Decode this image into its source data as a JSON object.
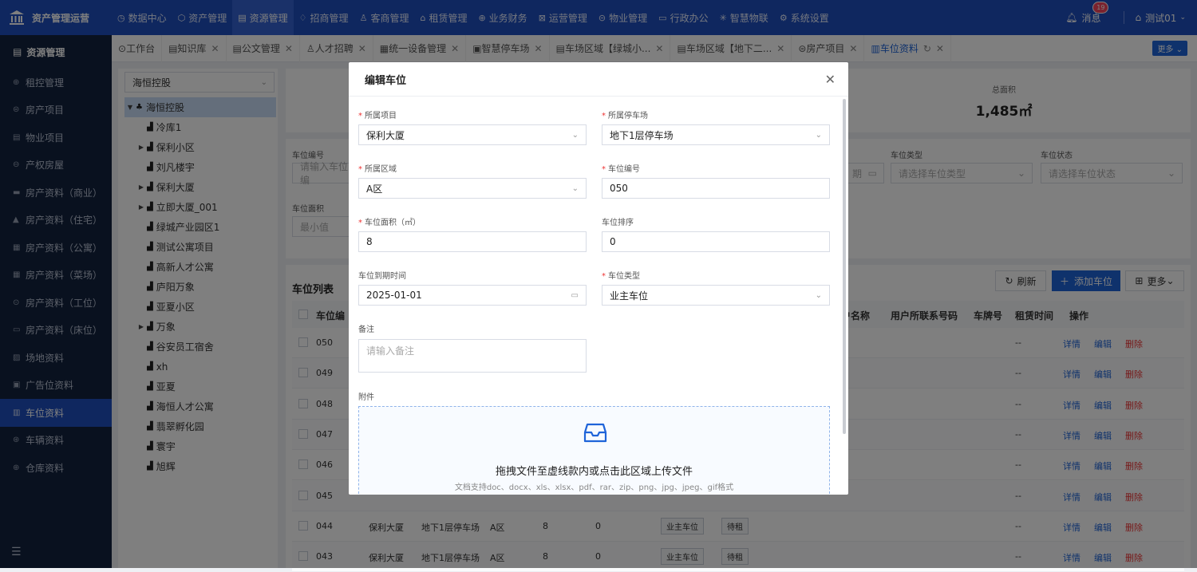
{
  "brand": {
    "title": "资产管理运营"
  },
  "topnav": [
    {
      "icon": "◷",
      "label": "数据中心"
    },
    {
      "icon": "⬡",
      "label": "资产管理"
    },
    {
      "icon": "▤",
      "label": "资源管理"
    },
    {
      "icon": "♢",
      "label": "招商管理"
    },
    {
      "icon": "♙",
      "label": "客商管理"
    },
    {
      "icon": "⌂",
      "label": "租赁管理"
    },
    {
      "icon": "⊕",
      "label": "业务财务"
    },
    {
      "icon": "⊠",
      "label": "运营管理"
    },
    {
      "icon": "⊝",
      "label": "物业管理"
    },
    {
      "icon": "▭",
      "label": "行政办公"
    },
    {
      "icon": "✳",
      "label": "智慧物联"
    },
    {
      "icon": "⚙",
      "label": "系统设置"
    }
  ],
  "topright": {
    "messages": "消息",
    "badge": "19",
    "user": "测试01"
  },
  "sidebar": {
    "title": "资源管理",
    "items": [
      "租控管理",
      "房产项目",
      "物业项目",
      "产权房屋",
      "房产资料（商业）",
      "房产资料（住宅）",
      "房产资料（公寓）",
      "房产资料（菜场）",
      "房产资料（工位）",
      "房产资料（床位）",
      "场地资料",
      "广告位资料",
      "车位资料",
      "车辆资料",
      "仓库资料"
    ]
  },
  "tabs": [
    {
      "label": "工作台",
      "closable": false
    },
    {
      "label": "知识库",
      "closable": true
    },
    {
      "label": "公文管理",
      "closable": true
    },
    {
      "label": "人才招聘",
      "closable": true
    },
    {
      "label": "统一设备管理",
      "closable": true
    },
    {
      "label": "智慧停车场",
      "closable": true
    },
    {
      "label": "车场区域【绿城小...",
      "closable": true
    },
    {
      "label": "车场区域【地下二...",
      "closable": true
    },
    {
      "label": "房产项目",
      "closable": true
    },
    {
      "label": "车位资料",
      "closable": true
    }
  ],
  "more_tabs": "更多",
  "tree": {
    "select_value": "海恒控股",
    "root": "海恒控股",
    "nodes": [
      {
        "label": "冷库1",
        "expandable": false
      },
      {
        "label": "保利小区",
        "expandable": true
      },
      {
        "label": "刘凡楼宇",
        "expandable": false
      },
      {
        "label": "保利大厦",
        "expandable": true
      },
      {
        "label": "立即大厦_001",
        "expandable": true
      },
      {
        "label": "绿城产业园区1",
        "expandable": false
      },
      {
        "label": "测试公寓项目",
        "expandable": false
      },
      {
        "label": "高新人才公寓",
        "expandable": false
      },
      {
        "label": "庐阳万象",
        "expandable": false
      },
      {
        "label": "亚夏小区",
        "expandable": false
      },
      {
        "label": "万象",
        "expandable": true
      },
      {
        "label": "谷安员工宿舍",
        "expandable": false
      },
      {
        "label": "xh",
        "expandable": false
      },
      {
        "label": "亚夏",
        "expandable": false
      },
      {
        "label": "海恒人才公寓",
        "expandable": false
      },
      {
        "label": "翡翠孵化园",
        "expandable": false
      },
      {
        "label": "寰宇",
        "expandable": false
      },
      {
        "label": "旭辉",
        "expandable": false
      }
    ]
  },
  "stats": {
    "total_area_label": "总面积",
    "total_area_value": "1,485㎡"
  },
  "filters": {
    "code_label": "车位编号",
    "code_placeholder": "请输入车位编",
    "type_label": "车位类型",
    "type_placeholder": "请选择车位类型",
    "status_label": "车位状态",
    "status_placeholder": "请选择车位状态",
    "area_label": "车位面积",
    "area_placeholder": "最小值"
  },
  "table": {
    "title": "车位列表",
    "refresh": "刷新",
    "add": "添加车位",
    "more": "更多",
    "headers": {
      "code": "车位编",
      "username": "户名称",
      "userphone": "用户所联系号码",
      "plate": "车牌号",
      "rent_time": "租赁时间",
      "ops": "操作"
    },
    "actions": {
      "detail": "详情",
      "edit": "编辑",
      "delete": "删除"
    },
    "rows": [
      {
        "code": "050",
        "project": "",
        "lot": "",
        "area": "",
        "size": "",
        "order": "",
        "type": "",
        "status": "",
        "rent": "--"
      },
      {
        "code": "049",
        "project": "",
        "lot": "",
        "area": "",
        "size": "",
        "order": "",
        "type": "",
        "status": "",
        "rent": "--"
      },
      {
        "code": "048",
        "project": "",
        "lot": "",
        "area": "",
        "size": "",
        "order": "",
        "type": "",
        "status": "",
        "rent": "--"
      },
      {
        "code": "047",
        "project": "",
        "lot": "",
        "area": "",
        "size": "",
        "order": "",
        "type": "",
        "status": "",
        "rent": "--"
      },
      {
        "code": "046",
        "project": "",
        "lot": "",
        "area": "",
        "size": "",
        "order": "",
        "type": "",
        "status": "",
        "rent": "--"
      },
      {
        "code": "045",
        "project": "",
        "lot": "",
        "area": "",
        "size": "",
        "order": "",
        "type": "",
        "status": "",
        "rent": "--"
      },
      {
        "code": "044",
        "project": "保利大厦",
        "lot": "地下1层停车场",
        "area": "A区",
        "size": "8",
        "order": "0",
        "type": "业主车位",
        "status": "待租",
        "rent": "--"
      },
      {
        "code": "043",
        "project": "保利大厦",
        "lot": "地下1层停车场",
        "area": "A区",
        "size": "8",
        "order": "0",
        "type": "业主车位",
        "status": "待租",
        "rent": "--"
      }
    ]
  },
  "modal": {
    "title": "编辑车位",
    "fields": {
      "project_label": "所属项目",
      "project_value": "保利大厦",
      "parking_label": "所属停车场",
      "parking_value": "地下1层停车场",
      "zone_label": "所属区域",
      "zone_value": "A区",
      "code_label": "车位编号",
      "code_value": "050",
      "area_label": "车位面积（㎡）",
      "area_value": "8",
      "order_label": "车位排序",
      "order_value": "0",
      "expire_label": "车位到期时间",
      "expire_value": "2025-01-01",
      "type_label": "车位类型",
      "type_value": "业主车位",
      "remark_label": "备注",
      "remark_placeholder": "请输入备注",
      "attach_label": "附件"
    },
    "upload": {
      "main": "拖拽文件至虚线款内或点击此区域上传文件",
      "sub": "文档支持doc、docx、xls、xlsx、pdf、rar、zip、png、jpg、jpeg、gif格式"
    }
  }
}
